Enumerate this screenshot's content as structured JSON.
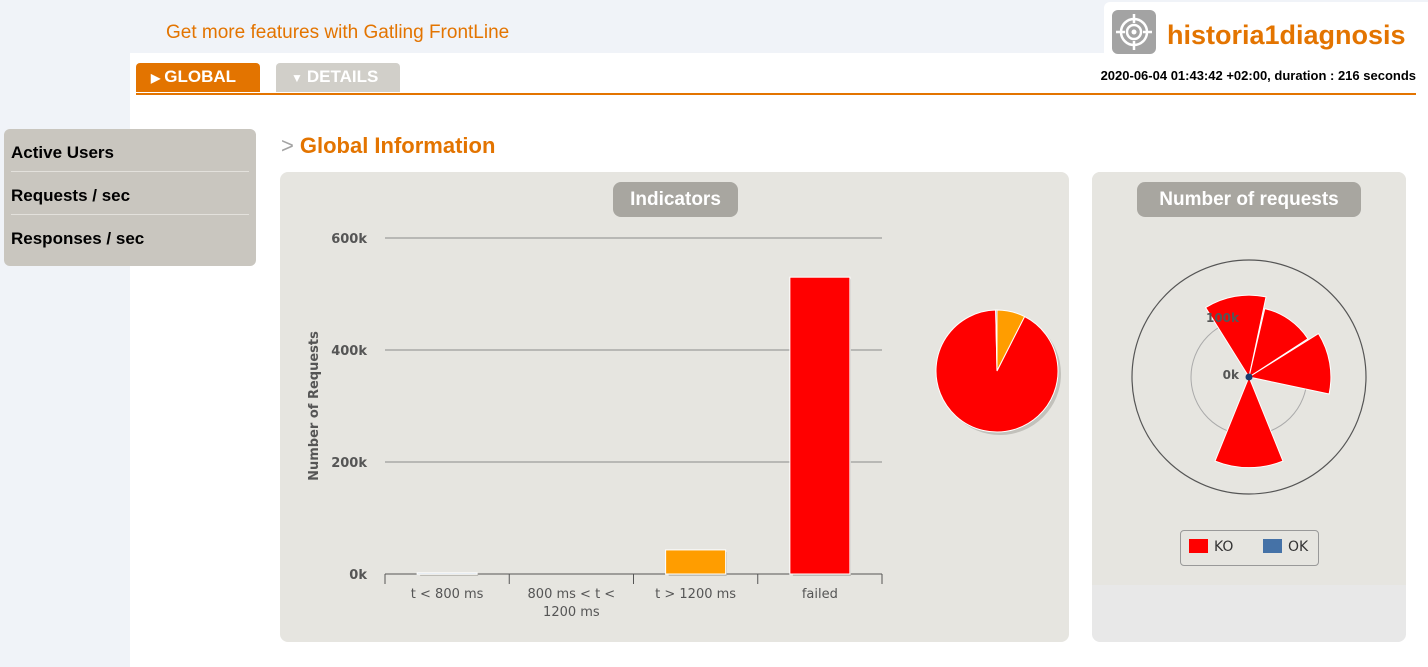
{
  "header": {
    "frontline_link": "Get more features with Gatling FrontLine",
    "simulation_name": "historia1diagnosis",
    "run_info": "2020-06-04 01:43:42 +02:00, duration : 216 seconds",
    "logo_icon": "target-icon"
  },
  "tabs": [
    {
      "label": "GLOBAL",
      "icon": "caret-right-icon",
      "active": true
    },
    {
      "label": "DETAILS",
      "icon": "caret-down-icon",
      "active": false
    }
  ],
  "sidebar": {
    "items": [
      {
        "label": "Active Users"
      },
      {
        "label": "Requests / sec"
      },
      {
        "label": "Responses / sec"
      }
    ]
  },
  "section": {
    "arrow": ">",
    "title": "Global Information"
  },
  "colors": {
    "accent": "#e37400",
    "ko": "#ff0000",
    "ok": "#4572a7",
    "warn": "#ff9d00"
  },
  "chart_data": [
    {
      "type": "bar",
      "title": "Indicators",
      "ylabel": "Number of Requests",
      "ylim": [
        0,
        600000
      ],
      "yticks": [
        0,
        200000,
        400000,
        600000
      ],
      "ytick_labels": [
        "0k",
        "200k",
        "400k",
        "600k"
      ],
      "categories": [
        "t < 800 ms",
        "800 ms < t < 1200 ms",
        "t > 1200 ms",
        "failed"
      ],
      "category_lines": [
        [
          "t < 800 ms"
        ],
        [
          "800 ms < t <",
          "1200 ms"
        ],
        [
          "t > 1200 ms"
        ],
        [
          "failed"
        ]
      ],
      "values": [
        2000,
        0,
        43000,
        530000
      ],
      "colors": [
        "#4572a7",
        "#ffdd00",
        "#ff9d00",
        "#ff0000"
      ],
      "grid": true
    },
    {
      "type": "pie",
      "values": [
        530000,
        43000,
        0,
        2000
      ],
      "colors": [
        "#ff0000",
        "#ff9d00",
        "#ffdd00",
        "#4572a7"
      ]
    },
    {
      "type": "polar-bar",
      "title": "Number of requests",
      "rtick_labels": [
        "0k",
        "100k"
      ],
      "series": [
        {
          "name": "KO",
          "color": "#ff0000"
        },
        {
          "name": "OK",
          "color": "#4572a7"
        }
      ],
      "values_ko": [
        140000,
        120000,
        140000,
        155000
      ],
      "legend": [
        "KO",
        "OK"
      ]
    }
  ]
}
